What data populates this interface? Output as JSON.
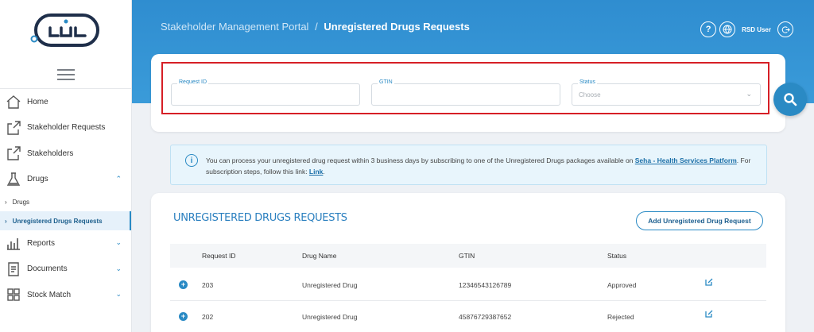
{
  "header": {
    "portal": "Stakeholder Management Portal",
    "separator": "/",
    "page": "Unregistered Drugs Requests",
    "user": "RSD User"
  },
  "sidebar": {
    "items": [
      {
        "label": "Home",
        "icon": "home-icon"
      },
      {
        "label": "Stakeholder Requests",
        "icon": "export-icon"
      },
      {
        "label": "Stakeholders",
        "icon": "export-icon"
      },
      {
        "label": "Drugs",
        "icon": "flask-icon",
        "expanded": true
      },
      {
        "label": "Reports",
        "icon": "bar-chart-icon"
      },
      {
        "label": "Documents",
        "icon": "document-icon"
      },
      {
        "label": "Stock Match",
        "icon": "grid-icon"
      }
    ],
    "drugs_sub": [
      {
        "label": "Drugs"
      },
      {
        "label": "Unregistered Drugs Requests",
        "active": true
      }
    ]
  },
  "filters": {
    "request_id_label": "Request ID",
    "gtin_label": "GTIN",
    "status_label": "Status",
    "status_placeholder": "Choose"
  },
  "info": {
    "text_before": "You can process your unregistered drug request within 3 business days by subscribing to one of the Unregistered Drugs packages available on ",
    "link1": "Seha - Health Services Platform",
    "text_middle": ". For subscription steps, follow this link: ",
    "link2": "Link",
    "text_after": "."
  },
  "table": {
    "title": "UNREGISTERED DRUGS REQUESTS",
    "add_button": "Add Unregistered Drug Request",
    "columns": [
      "Request ID",
      "Drug Name",
      "GTIN",
      "Status"
    ],
    "rows": [
      {
        "id": "203",
        "name": "Unregistered Drug",
        "gtin": "12346543126789",
        "status": "Approved"
      },
      {
        "id": "202",
        "name": "Unregistered Drug",
        "gtin": "45876729387652",
        "status": "Rejected"
      }
    ]
  },
  "colors": {
    "primary": "#2a8ac4",
    "header": "#3a9bd9",
    "highlight_border": "#d61f26"
  }
}
